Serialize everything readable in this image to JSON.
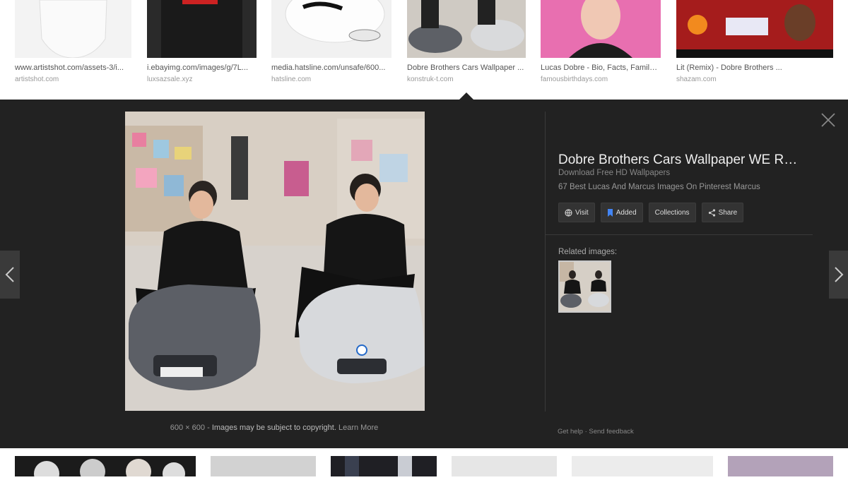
{
  "top_results": [
    {
      "title": "www.artistshot.com/assets-3/i...",
      "domain": "artistshot.com"
    },
    {
      "title": "i.ebayimg.com/images/g/7L...",
      "domain": "luxsazsale.xyz"
    },
    {
      "title": "media.hatsline.com/unsafe/600...",
      "domain": "hatsline.com"
    },
    {
      "title": "Dobre Brothers Cars Wallpaper ...",
      "domain": "konstruk-t.com"
    },
    {
      "title": "Lucas Dobre - Bio, Facts, Family ...",
      "domain": "famousbirthdays.com"
    },
    {
      "title": "Lit (Remix) - Dobre Brothers ...",
      "domain": "shazam.com"
    }
  ],
  "preview": {
    "title": "Dobre Brothers Cars Wallpaper WE RA...",
    "subtitle": "Download Free HD Wallpapers",
    "description": "67 Best Lucas And Marcus Images On Pinterest Marcus",
    "dimensions": "600 × 600",
    "separator": "-",
    "copyright": "Images may be subject to copyright.",
    "learn_more": "Learn More",
    "related_label": "Related images:",
    "get_help": "Get help",
    "dot": "·",
    "send_feedback": "Send feedback"
  },
  "actions": {
    "visit": "Visit",
    "added": "Added",
    "collections": "Collections",
    "share": "Share"
  },
  "colors": {
    "panel_bg": "#222222",
    "added_icon": "#4285f4"
  }
}
